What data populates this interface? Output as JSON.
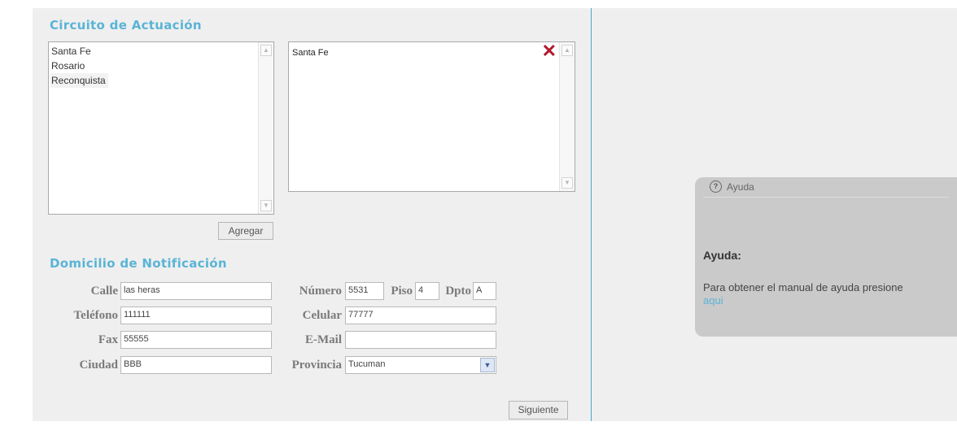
{
  "circuito": {
    "title": "Circuito de Actuación",
    "available": [
      "Santa Fe",
      "Rosario",
      "Reconquista"
    ],
    "selected": [
      "Santa Fe"
    ],
    "add_label": "Agregar"
  },
  "domicilio": {
    "title": "Domicilio de Notificación",
    "fields": {
      "calle": {
        "label": "Calle",
        "value": "las heras"
      },
      "numero": {
        "label": "Número",
        "value": "5531"
      },
      "piso": {
        "label": "Piso",
        "value": "4"
      },
      "dpto": {
        "label": "Dpto",
        "value": "A"
      },
      "telefono": {
        "label": "Teléfono",
        "value": "111111"
      },
      "celular": {
        "label": "Celular",
        "value": "77777"
      },
      "fax": {
        "label": "Fax",
        "value": "55555"
      },
      "email": {
        "label": "E-Mail",
        "value": ""
      },
      "ciudad": {
        "label": "Ciudad",
        "value": "BBB"
      },
      "provincia": {
        "label": "Provincia",
        "value": "Tucuman"
      }
    }
  },
  "next_label": "Siguiente",
  "help": {
    "header": "Ayuda",
    "title": "Ayuda:",
    "text": "Para obtener el manual de ayuda presione",
    "link": "aqui"
  },
  "colors": {
    "accent": "#5ab4d6",
    "panel": "#efefef",
    "help_bg": "#cacaca",
    "remove": "#b2182b"
  }
}
